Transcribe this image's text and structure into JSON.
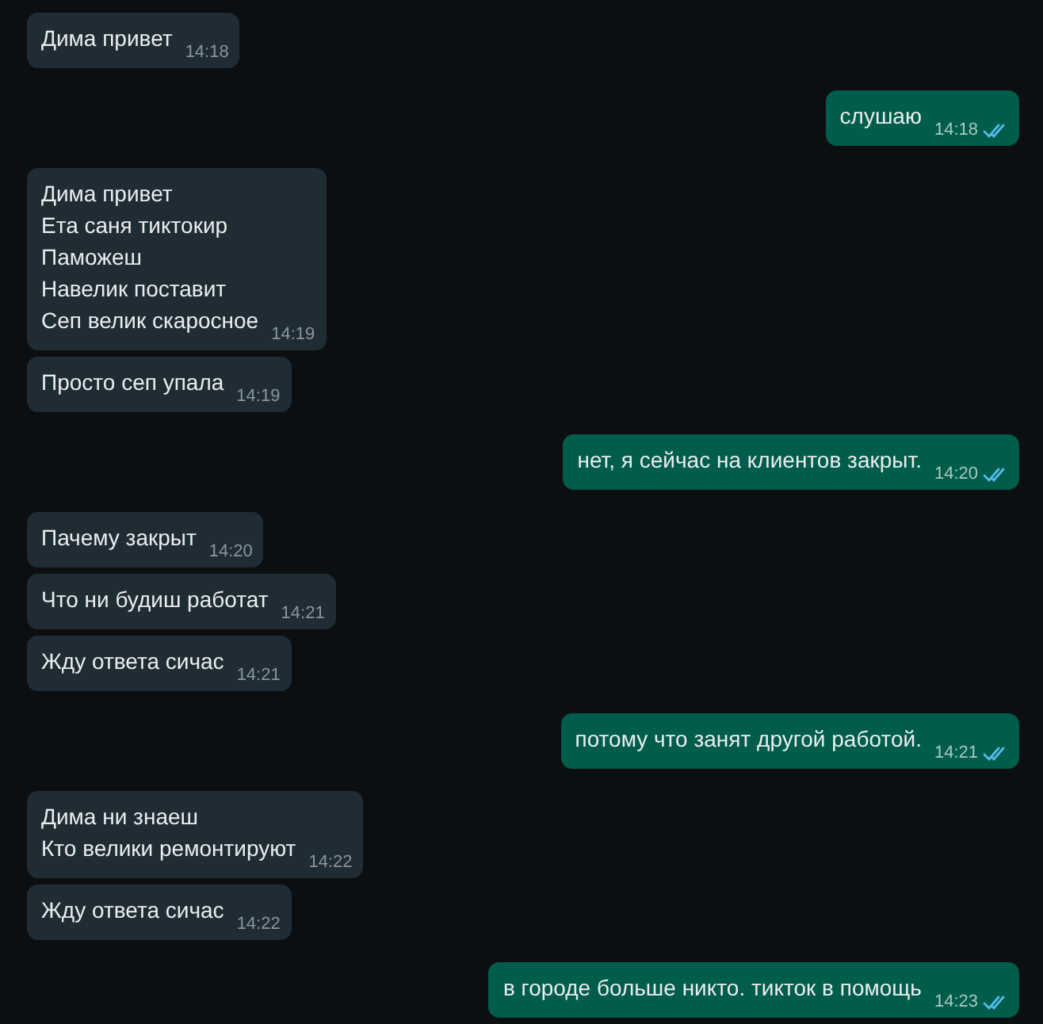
{
  "messages": [
    {
      "kind": "incoming",
      "text": "Дима привет",
      "time": "14:18"
    },
    {
      "kind": "outgoing",
      "text": "слушаю",
      "time": "14:18",
      "read": true
    },
    {
      "kind": "incoming",
      "text": "Дима привет\nЕта саня тиктокир\nПаможеш\nНавелик поставит\nСеп велик скаросное",
      "time": "14:19"
    },
    {
      "kind": "incoming",
      "text": "Просто сеп упала",
      "time": "14:19"
    },
    {
      "kind": "outgoing",
      "text": "нет, я сейчас на клиентов закрыт.",
      "time": "14:20",
      "read": true
    },
    {
      "kind": "incoming",
      "text": "Пачему закрыт",
      "time": "14:20"
    },
    {
      "kind": "incoming",
      "text": "Что ни будиш работат",
      "time": "14:21"
    },
    {
      "kind": "incoming",
      "text": "Жду ответа сичас",
      "time": "14:21"
    },
    {
      "kind": "outgoing",
      "text": "потому что занят другой работой.",
      "time": "14:21",
      "read": true
    },
    {
      "kind": "incoming",
      "text": "Дима ни знаеш\nКто велики ремонтируют",
      "time": "14:22"
    },
    {
      "kind": "incoming",
      "text": "Жду ответа сичас",
      "time": "14:22"
    },
    {
      "kind": "outgoing",
      "text": "в городе больше никто. тикток в помощь",
      "time": "14:23",
      "read": true
    }
  ]
}
